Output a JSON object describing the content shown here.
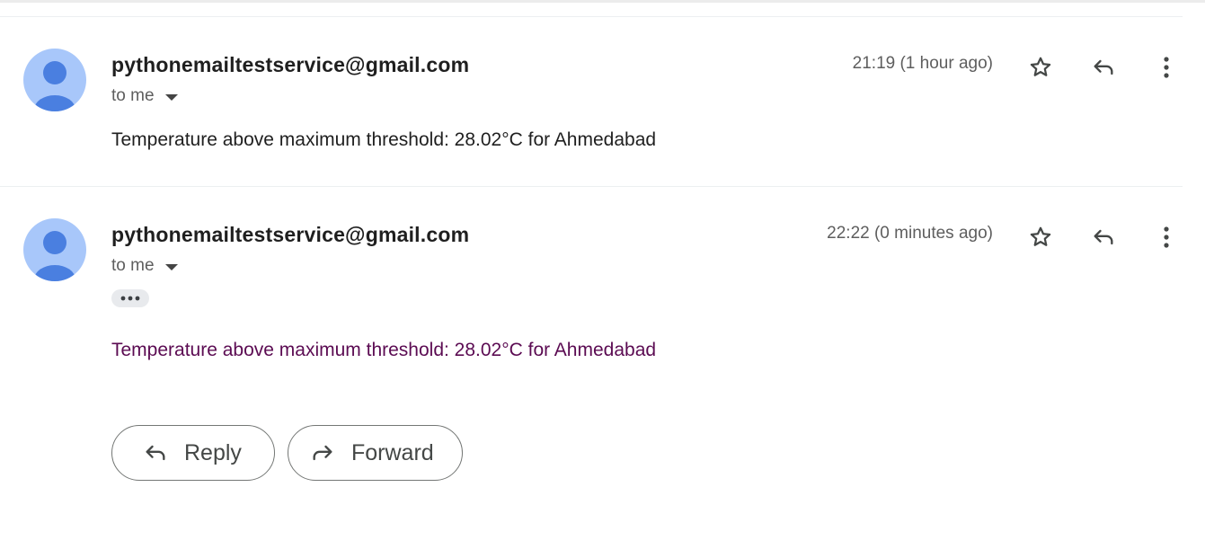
{
  "messages": [
    {
      "sender": "pythonemailtestservice@gmail.com",
      "recipient": "to me",
      "time": "21:19 (1 hour ago)",
      "body": "Temperature above maximum threshold: 28.02°C for Ahmedabad",
      "body_color": "#1f1f1f"
    },
    {
      "sender": "pythonemailtestservice@gmail.com",
      "recipient": "to me",
      "time": "22:22 (0 minutes ago)",
      "body": "Temperature above maximum threshold: 28.02°C for Ahmedabad",
      "body_color": "#5b0b52"
    }
  ],
  "actions": {
    "reply_label": "Reply",
    "forward_label": "Forward"
  },
  "icons": {
    "star": "star-icon",
    "reply": "reply-icon",
    "more": "more-vert-icon",
    "caret": "caret-down-icon",
    "forward": "forward-icon",
    "ellipsis": "show-trimmed-content-icon"
  },
  "colors": {
    "avatar_bg": "#a8c7fa",
    "avatar_fg": "#4a7fe0",
    "second_body_text": "#5b0b52"
  }
}
